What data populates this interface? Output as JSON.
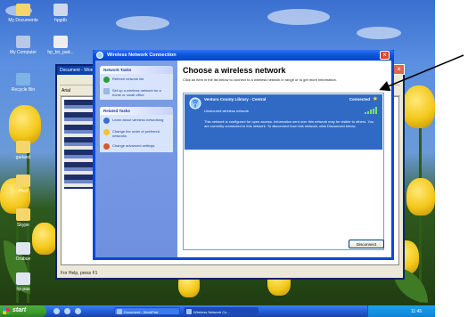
{
  "desktop": {
    "icons": [
      {
        "label": "My Documents"
      },
      {
        "label": "hpgdb"
      },
      {
        "label": "My Computer"
      },
      {
        "label": "hp_bir_pad..."
      },
      {
        "label": "Recycle Bin"
      },
      {
        "label": "garland"
      },
      {
        "label": "Pholl"
      },
      {
        "label": "Skype"
      },
      {
        "label": "Orabue"
      },
      {
        "label": "hp pas"
      }
    ]
  },
  "wordpad": {
    "title": "Document - WordPad",
    "font_box": "Arial",
    "status": "For Help, press F1"
  },
  "dialog": {
    "title": "Wireless Network Connection",
    "heading": "Choose a wireless network",
    "intro": "Click an item in the list below to connect to a wireless network in range or to get more information.",
    "network_tasks": {
      "header": "Network Tasks",
      "items": [
        {
          "label": "Refresh network list",
          "icon": "refresh-icon"
        },
        {
          "label": "Set up a wireless network for a home or small office",
          "icon": "setup-network-icon"
        }
      ]
    },
    "related_tasks": {
      "header": "Related Tasks",
      "items": [
        {
          "label": "Learn about wireless networking",
          "icon": "info-icon"
        },
        {
          "label": "Change the order of preferred networks",
          "icon": "star-icon"
        },
        {
          "label": "Change advanced settings",
          "icon": "settings-icon"
        }
      ]
    },
    "network": {
      "name": "Ventura County Library - Central",
      "status": "Connected",
      "security": "Unsecured wireless network",
      "description": "This network is configured for open access. Information sent over this network may be visible to others. You are currently connected to this network. To disconnect from this network, click Disconnect below.",
      "signal_bars": 5
    },
    "disconnect_label": "Disconnect"
  },
  "taskbar": {
    "start_label": "start",
    "tasks": [
      {
        "label": "Document - WordPad"
      },
      {
        "label": "Wireless Network Co..."
      }
    ],
    "clock": "11:45"
  },
  "colors": {
    "selection": "#316ac5",
    "title_bar": "#0a52e0",
    "task_pane": "#7a9ee8"
  }
}
